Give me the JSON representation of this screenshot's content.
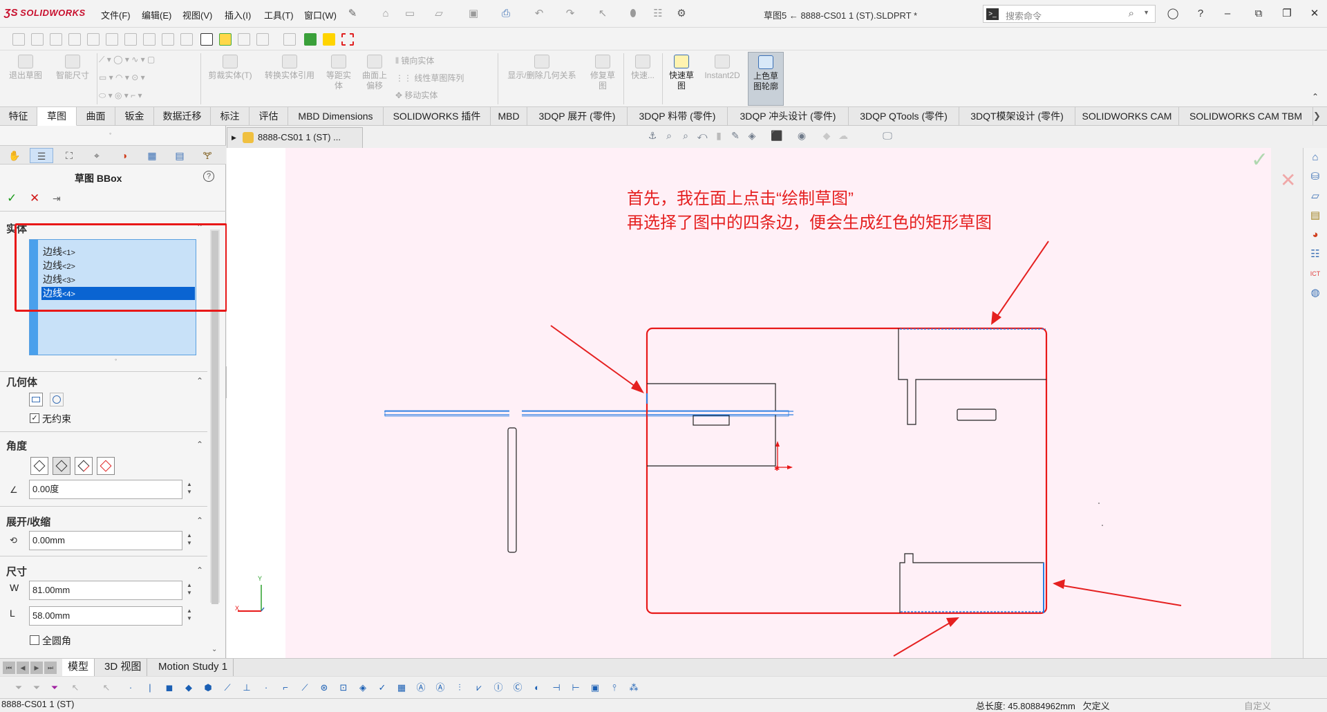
{
  "app": {
    "logo_text": "SOLIDWORKS",
    "document_title": "草图5 ← 8888-CS01 1 (ST).SLDPRT *"
  },
  "menu": [
    "文件(F)",
    "编辑(E)",
    "视图(V)",
    "插入(I)",
    "工具(T)",
    "窗口(W)"
  ],
  "search": {
    "placeholder": "搜索命令"
  },
  "ribbon": {
    "exit_sketch": "退出草图",
    "smart_dimension": "智能尺寸",
    "trim": "剪裁实体(T)",
    "convert": "转换实体引用",
    "offset_line1": "等距实",
    "offset_line2": "体",
    "surface_offset_line1": "曲面上",
    "surface_offset_line2": "偏移",
    "mirror": "镜向实体",
    "linear_pattern": "线性草图阵列",
    "move": "移动实体",
    "relations": "显示/删除几何关系",
    "repair_line1": "修复草",
    "repair_line2": "图",
    "quick_snaps": "快速...",
    "rapid_sketch_line1": "快速草",
    "rapid_sketch_line2": "图",
    "instant2d": "Instant2D",
    "shaded_line1": "上色草",
    "shaded_line2": "图轮廓"
  },
  "tabs": [
    "特征",
    "草图",
    "曲面",
    "钣金",
    "数据迁移",
    "标注",
    "评估",
    "MBD Dimensions",
    "SOLIDWORKS 插件",
    "MBD",
    "3DQP 展开 (零件)",
    "3DQP 料带 (零件)",
    "3DQP 冲头设计 (零件)",
    "3DQP QTools (零件)",
    "3DQT模架设计 (零件)",
    "SOLIDWORKS CAM",
    "SOLIDWORKS CAM TBM"
  ],
  "active_tab": "草图",
  "property_manager": {
    "title": "草图 BBox",
    "help": "?",
    "entities_section": "实体",
    "entities": [
      {
        "name": "边线",
        "index": "<1>"
      },
      {
        "name": "边线",
        "index": "<2>"
      },
      {
        "name": "边线",
        "index": "<3>"
      },
      {
        "name": "边线",
        "index": "<4>"
      }
    ],
    "geometry_section": "几何体",
    "no_constraint_label": "无约束",
    "angle_section": "角度",
    "angle_value": "0.00度",
    "expand_section": "展开/收缩",
    "expand_value": "0.00mm",
    "size_section": "尺寸",
    "width_label": "W",
    "width_value": "81.00mm",
    "length_label": "L",
    "length_value": "58.00mm",
    "full_round_label": "全圆角"
  },
  "document_tab": {
    "label": "8888-CS01 1 (ST) ..."
  },
  "annotation": {
    "line1": "首先，我在面上点击“绘制草图”",
    "line2": "再选择了图中的四条边，便会生成红色的矩形草图"
  },
  "triad": {
    "x": "X",
    "y": "Y"
  },
  "bottom_tabs": [
    "模型",
    "3D 视图",
    "Motion Study 1"
  ],
  "status": {
    "left": "8888-CS01 1 (ST)",
    "total_length": "总长度: 45.80884962mm",
    "state": "欠定义",
    "custom": "自定义"
  },
  "colors": {
    "sketch_red": "#e81818",
    "edge_blue": "#2a7de1",
    "background_pink": "#fff0f7",
    "selection_blue": "#0a64d2"
  }
}
